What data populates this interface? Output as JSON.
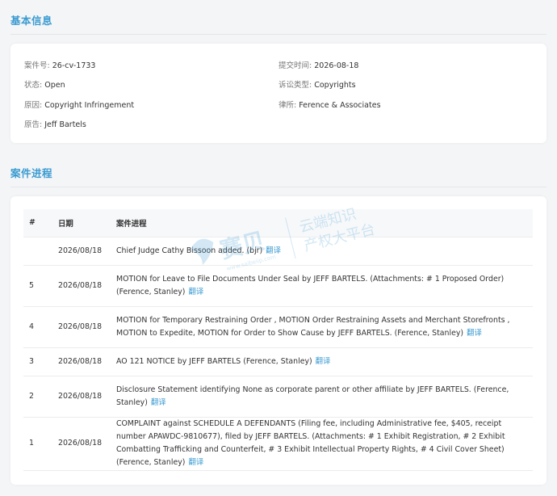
{
  "basic_info": {
    "title": "基本信息",
    "case_number": {
      "label": "案件号:",
      "value": "26-cv-1733"
    },
    "filing_date": {
      "label": "提交时间:",
      "value": "2026-08-18"
    },
    "status": {
      "label": "状态:",
      "value": "Open"
    },
    "suit_type": {
      "label": "诉讼类型:",
      "value": "Copyrights"
    },
    "cause": {
      "label": "原因:",
      "value": "Copyright Infringement"
    },
    "law_firm": {
      "label": "律所:",
      "value": "Ference & Associates"
    },
    "plaintiff": {
      "label": "原告:",
      "value": "Jeff Bartels"
    }
  },
  "progress": {
    "title": "案件进程",
    "columns": [
      "#",
      "日期",
      "案件进程"
    ],
    "translate_label": "翻译",
    "rows": [
      {
        "num": "",
        "date": "2026/08/18",
        "event": "Chief Judge Cathy Bissoon added. (bjr)"
      },
      {
        "num": "5",
        "date": "2026/08/18",
        "event": "MOTION for Leave to File Documents Under Seal by JEFF BARTELS. (Attachments: # 1 Proposed Order) (Ference, Stanley)"
      },
      {
        "num": "4",
        "date": "2026/08/18",
        "event": "MOTION for Temporary Restraining Order , MOTION Order Restraining Assets and Merchant Storefronts , MOTION to Expedite, MOTION for Order to Show Cause by JEFF BARTELS. (Ference, Stanley)"
      },
      {
        "num": "3",
        "date": "2026/08/18",
        "event": "AO 121 NOTICE by JEFF BARTELS (Ference, Stanley)"
      },
      {
        "num": "2",
        "date": "2026/08/18",
        "event": "Disclosure Statement identifying None as corporate parent or other affiliate by JEFF BARTELS. (Ference, Stanley)"
      },
      {
        "num": "1",
        "date": "2026/08/18",
        "event": "COMPLAINT against SCHEDULE A DEFENDANTS (Filing fee, including Administrative fee, $405, receipt number APAWDC-9810677), filed by JEFF BARTELS. (Attachments: # 1 Exhibit Registration, # 2 Exhibit Combatting Trafficking and Counterfeit, # 3 Exhibit Intellectual Property Rights, # 4 Civil Cover Sheet) (Ference, Stanley)"
      }
    ]
  },
  "watermark": {
    "brand": "赛贝",
    "url": "www.saibeiip.com",
    "tagline_1": "云端知识",
    "tagline_2": "产权大平台"
  }
}
